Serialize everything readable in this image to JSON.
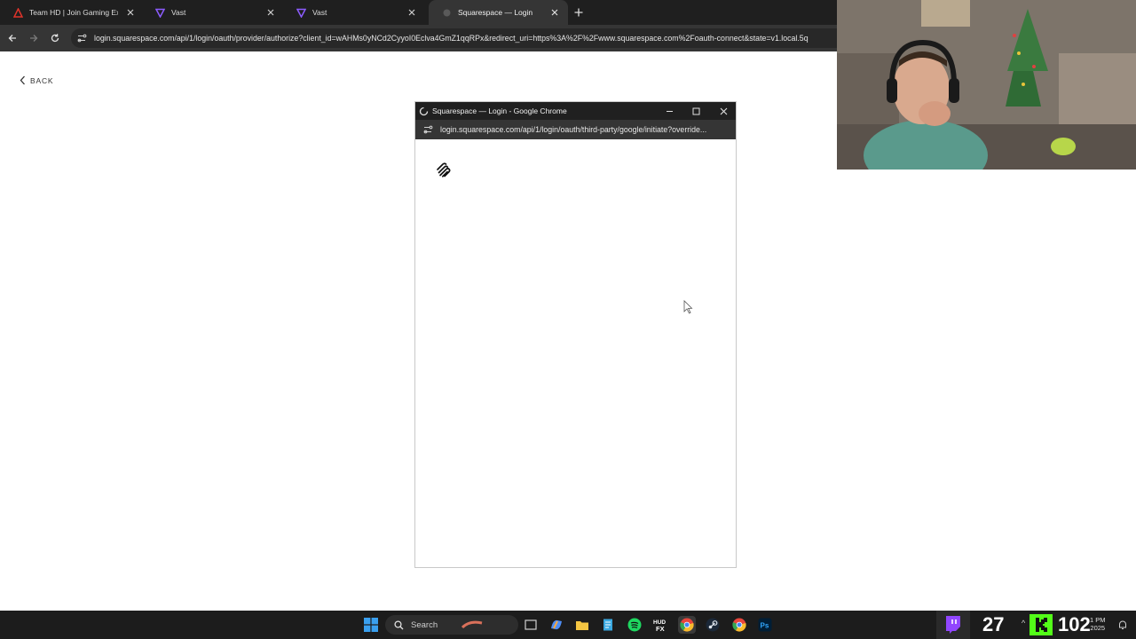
{
  "browser": {
    "tabs": [
      {
        "title": "Team HD | Join Gaming Excelle",
        "favicon": "team-hd-icon",
        "active": false
      },
      {
        "title": "Vast",
        "favicon": "vast-icon",
        "active": false
      },
      {
        "title": "Vast",
        "favicon": "vast-icon",
        "active": false
      },
      {
        "title": "Squarespace — Login",
        "favicon": "squarespace-icon",
        "active": true
      }
    ],
    "url": "login.squarespace.com/api/1/login/oauth/provider/authorize?client_id=wAHMs0yNCd2CyyoI0Eclva4GmZ1qqRPx&redirect_uri=https%3A%2F%2Fwww.squarespace.com%2Foauth-connect&state=v1.local.5q"
  },
  "page": {
    "back_label": "BACK"
  },
  "popup": {
    "title": "Squarespace — Login - Google Chrome",
    "url": "login.squarespace.com/api/1/login/oauth/third-party/google/initiate?override..."
  },
  "taskbar": {
    "search_label": "Search",
    "overlay_left": "27",
    "overlay_right": "102",
    "time": "1 PM",
    "date": "2025"
  },
  "colors": {
    "tab_bg": "#1f1f1f",
    "toolbar_bg": "#353535",
    "kick_green": "#53fc18",
    "twitch_purple": "#9146ff"
  }
}
